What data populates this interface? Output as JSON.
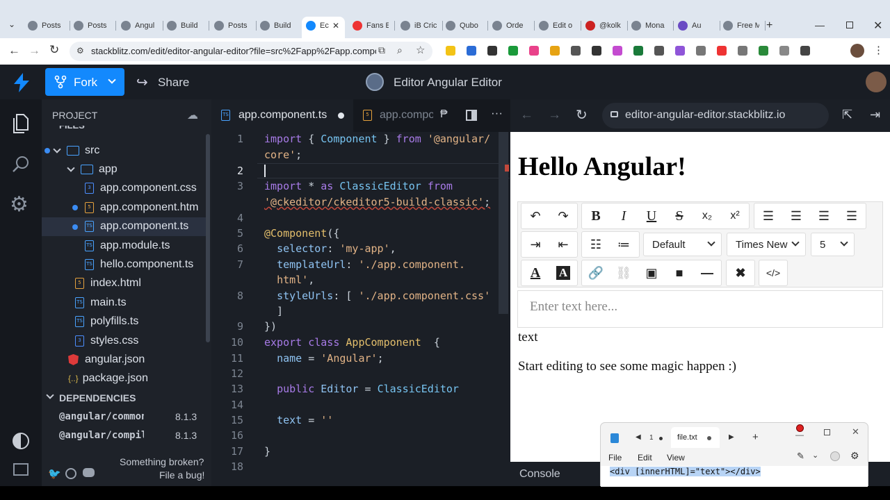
{
  "browser": {
    "tabs": [
      "Posts",
      "Posts",
      "Angul",
      "Build",
      "Posts",
      "Build",
      "Ec",
      "Fans E",
      "iB Cric",
      "Qubo",
      "Orde",
      "Edit o",
      "@kolk",
      "Mona",
      "Au",
      "Free M"
    ],
    "url": "stackblitz.com/edit/editor-angular-editor?file=src%2Fapp%2Fapp.componen..."
  },
  "stackblitz": {
    "fork_label": "Fork",
    "share_label": "Share",
    "project_title": "Editor Angular Editor"
  },
  "sidebar": {
    "project_label": "PROJECT",
    "files_label": "FILES",
    "tree": [
      {
        "label": "src",
        "type": "folder",
        "depth": 0,
        "dot": true
      },
      {
        "label": "app",
        "type": "folder",
        "depth": 1,
        "dot": false
      },
      {
        "label": "app.component.css",
        "type": "css",
        "depth": 2,
        "dot": false
      },
      {
        "label": "app.component.htm",
        "type": "html",
        "depth": 2,
        "dot": true
      },
      {
        "label": "app.component.ts",
        "type": "ts",
        "depth": 2,
        "dot": true,
        "selected": true
      },
      {
        "label": "app.module.ts",
        "type": "ts",
        "depth": 2,
        "dot": false
      },
      {
        "label": "hello.component.ts",
        "type": "ts",
        "depth": 2,
        "dot": false
      },
      {
        "label": "index.html",
        "type": "html",
        "depth": 1,
        "dot": false
      },
      {
        "label": "main.ts",
        "type": "ts",
        "depth": 1,
        "dot": false
      },
      {
        "label": "polyfills.ts",
        "type": "ts",
        "depth": 1,
        "dot": false
      },
      {
        "label": "styles.css",
        "type": "css",
        "depth": 1,
        "dot": false
      },
      {
        "label": "angular.json",
        "type": "angular",
        "depth": 0,
        "dot": false
      },
      {
        "label": "package.json",
        "type": "json",
        "depth": 0,
        "dot": false
      }
    ],
    "dependencies_label": "DEPENDENCIES",
    "dependencies": [
      {
        "name": "@angular/common",
        "version": "8.1.3"
      },
      {
        "name": "@angular/compile",
        "version": "8.1.3"
      }
    ],
    "broken_line1": "Something broken?",
    "broken_line2": "File a bug!"
  },
  "editor": {
    "tab_active": "app.component.ts",
    "tab_second": "app.compo",
    "line_numbers": [
      "1",
      "2",
      "3",
      "4",
      "5",
      "6",
      "7",
      "8",
      "9",
      "10",
      "11",
      "12",
      "13",
      "14",
      "15",
      "16",
      "17",
      "18"
    ]
  },
  "preview": {
    "url": "editor-angular-editor.stackblitz.io",
    "heading": "Hello Angular!",
    "font_style": "Default",
    "font_family": "Times New",
    "font_size": "5",
    "placeholder": "Enter text here...",
    "text_output": "text",
    "paragraph": "Start editing to see some magic happen :)",
    "console_label": "Console"
  },
  "notepad": {
    "tab_label": "file.txt",
    "tab_count": "1",
    "menu": [
      "File",
      "Edit",
      "View"
    ],
    "content": "<div [innerHTML]=\"text\"></div>"
  }
}
